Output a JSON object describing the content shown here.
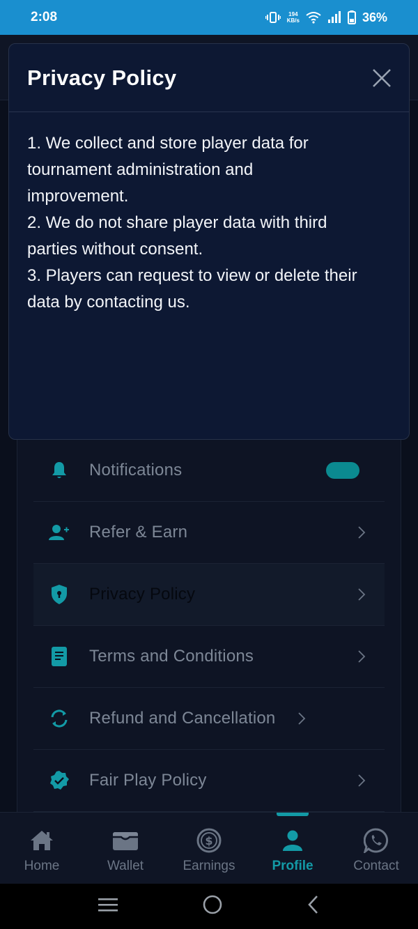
{
  "status_bar": {
    "time": "2:08",
    "net_speed_value": "194",
    "net_speed_unit": "KB/s",
    "battery": "36%"
  },
  "settings": {
    "items": [
      {
        "label": "Notifications",
        "icon": "bell-icon",
        "control": "toggle"
      },
      {
        "label": "Refer & Earn",
        "icon": "add-user-icon",
        "control": "chevron"
      },
      {
        "label": "Privacy Policy",
        "icon": "shield-icon",
        "control": "chevron"
      },
      {
        "label": "Terms and Conditions",
        "icon": "document-icon",
        "control": "chevron"
      },
      {
        "label": "Refund and Cancellation",
        "icon": "refresh-icon",
        "control": "chevron"
      },
      {
        "label": "Fair Play Policy",
        "icon": "verified-badge-icon",
        "control": "chevron"
      }
    ],
    "notifications_enabled": true
  },
  "bottom_nav": {
    "items": [
      {
        "label": "Home",
        "icon": "home-icon"
      },
      {
        "label": "Wallet",
        "icon": "wallet-icon"
      },
      {
        "label": "Earnings",
        "icon": "dollar-coin-icon"
      },
      {
        "label": "Profile",
        "icon": "user-icon"
      },
      {
        "label": "Contact",
        "icon": "whatsapp-icon"
      }
    ],
    "active": "Profile"
  },
  "modal": {
    "title": "Privacy Policy",
    "lines": [
      "1. We collect and store player data for",
      "tournament administration and",
      "improvement.",
      "2. We do not share player data with third",
      "parties without consent.",
      "3. Players can request to view or delete their",
      "data by contacting us."
    ]
  },
  "colors": {
    "accent": "#139aa6",
    "status_bar": "#1a8fcf",
    "modal_bg": "#0d1833",
    "page_bg": "#0a0f1c"
  }
}
